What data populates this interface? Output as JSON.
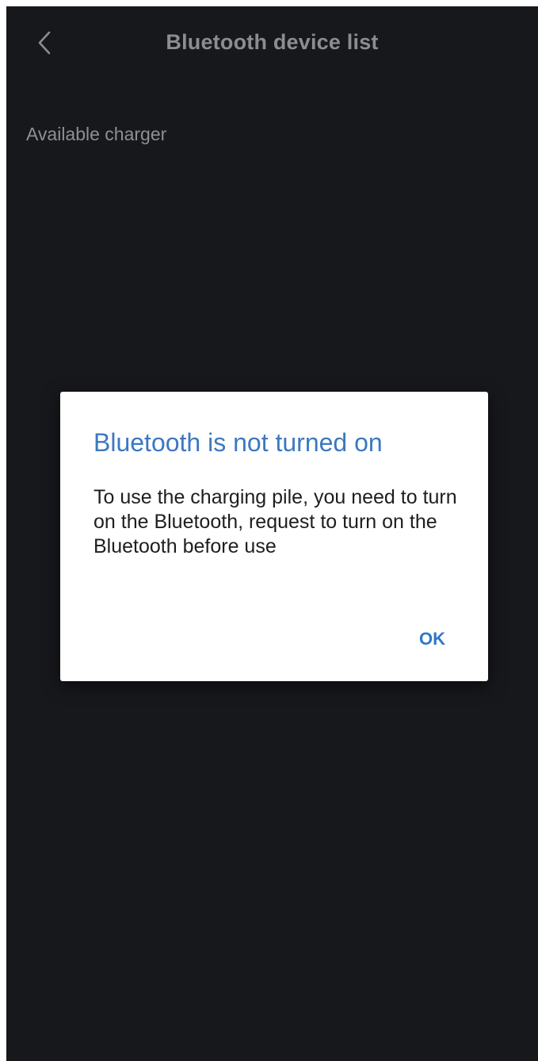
{
  "header": {
    "title": "Bluetooth device list",
    "back_icon": "chevron-left-icon"
  },
  "main": {
    "section_label": "Available charger"
  },
  "dialog": {
    "title": "Bluetooth is not turned on",
    "message": "To use the charging pile, you need to turn on the Bluetooth, request to turn on the Bluetooth before use",
    "ok_label": "OK"
  },
  "colors": {
    "background": "#17181c",
    "dialog_title": "#3c78c0",
    "ok_button": "#2f78c6"
  }
}
